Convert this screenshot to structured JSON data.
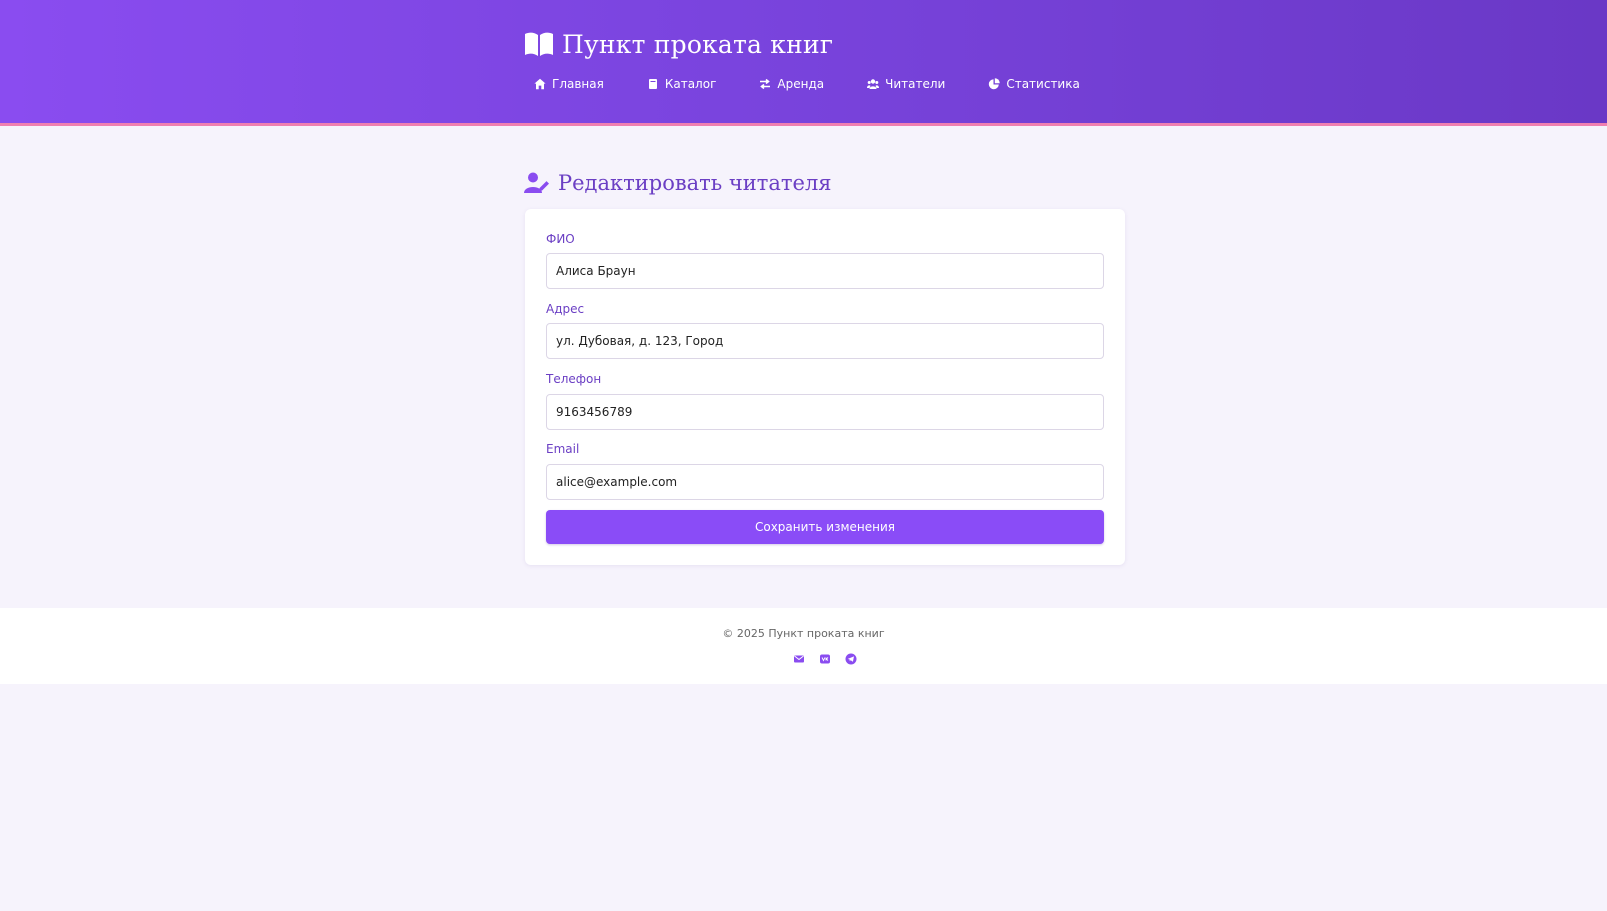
{
  "header": {
    "brand_title": "Пункт проката книг",
    "nav": [
      {
        "label": "Главная",
        "icon": "home-icon"
      },
      {
        "label": "Каталог",
        "icon": "book-icon"
      },
      {
        "label": "Аренда",
        "icon": "exchange-icon"
      },
      {
        "label": "Читатели",
        "icon": "users-icon"
      },
      {
        "label": "Статистика",
        "icon": "pie-chart-icon"
      }
    ]
  },
  "page": {
    "title": "Редактировать читателя",
    "title_icon": "user-edit-icon"
  },
  "form": {
    "fio": {
      "label": "ФИО",
      "value": "Алиса Браун"
    },
    "address": {
      "label": "Адрес",
      "value": "ул. Дубовая, д. 123, Город"
    },
    "phone": {
      "label": "Телефон",
      "value": "9163456789"
    },
    "email": {
      "label": "Email",
      "value": "alice@example.com"
    },
    "submit_label": "Сохранить изменения"
  },
  "footer": {
    "copyright": "© 2025 Пункт проката книг",
    "social": [
      "envelope-icon",
      "vk-icon",
      "telegram-icon"
    ]
  },
  "colors": {
    "header_gradient_start": "#8a4cf0",
    "header_gradient_end": "#6a38c6",
    "header_border": "#f07fb0",
    "accent": "#6b3fc4",
    "button": "#8a4cf7",
    "page_background": "#f6f3fc"
  }
}
